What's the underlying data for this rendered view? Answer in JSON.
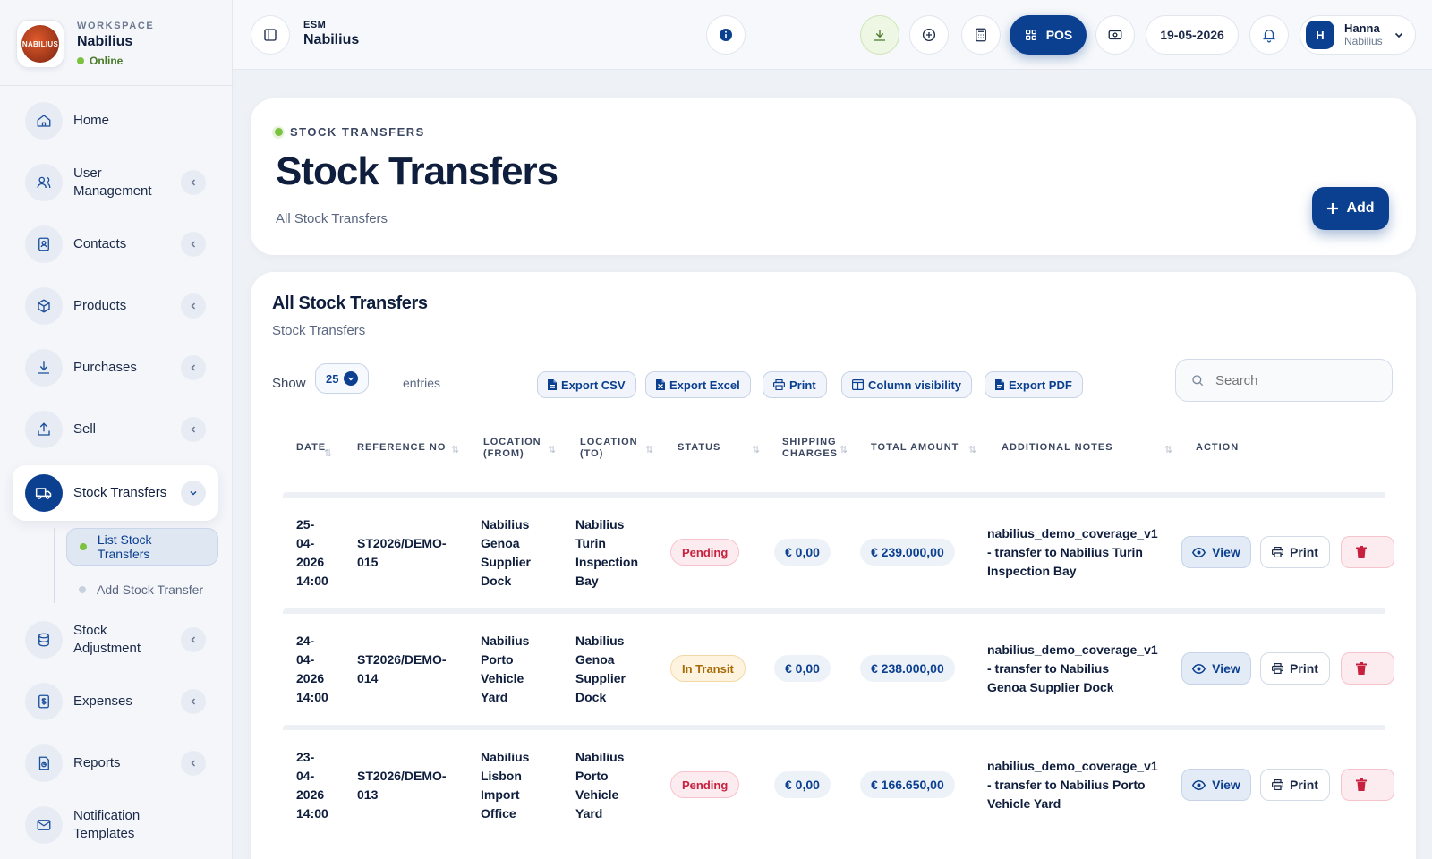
{
  "workspace": {
    "caption": "WORKSPACE",
    "name": "Nabilius",
    "status": "Online",
    "logo_text": "NABILIUS"
  },
  "sidebar": {
    "items": [
      {
        "label": "Home",
        "icon": "home-icon"
      },
      {
        "label": "User Management",
        "icon": "users-icon"
      },
      {
        "label": "Contacts",
        "icon": "contacts-icon"
      },
      {
        "label": "Products",
        "icon": "box-icon"
      },
      {
        "label": "Purchases",
        "icon": "download-icon"
      },
      {
        "label": "Sell",
        "icon": "upload-icon"
      },
      {
        "label": "Stock Transfers",
        "icon": "truck-icon"
      },
      {
        "label": "Stock Adjustment",
        "icon": "database-icon"
      },
      {
        "label": "Expenses",
        "icon": "receipt-icon"
      },
      {
        "label": "Reports",
        "icon": "report-icon"
      },
      {
        "label": "Notification Templates",
        "icon": "mail-icon"
      }
    ],
    "sub_items": [
      "List Stock Transfers",
      "Add Stock Transfer"
    ]
  },
  "topbar": {
    "caption": "ESM",
    "name": "Nabilius",
    "pos_label": "POS",
    "date": "19-05-2026",
    "user_initial": "H",
    "user_name": "Hanna",
    "user_org": "Nabilius"
  },
  "hero": {
    "eyebrow": "STOCK TRANSFERS",
    "title": "Stock Transfers",
    "subtitle": "All Stock Transfers",
    "add_label": "Add"
  },
  "table_card": {
    "title": "All Stock Transfers",
    "subtitle": "Stock Transfers",
    "show_label": "Show",
    "page_size": "25",
    "entries_label": "entries",
    "buttons": [
      "Export CSV",
      "Export Excel",
      "Print",
      "Column visibility",
      "Export PDF"
    ],
    "search_placeholder": "Search",
    "columns": [
      "DATE",
      "REFERENCE NO",
      "LOCATION (FROM)",
      "LOCATION (TO)",
      "STATUS",
      "SHIPPING CHARGES",
      "TOTAL AMOUNT",
      "ADDITIONAL NOTES",
      "ACTION"
    ],
    "rows": [
      {
        "date": "25-\n04-\n2026\n14:00",
        "ref": "ST2026/DEMO-\n015",
        "from": "Nabilius\nGenoa\nSupplier\nDock",
        "to": "Nabilius\nTurin\nInspection\nBay",
        "status": "Pending",
        "shipping": "€ 0,00",
        "total": "€ 239.000,00",
        "notes": "nabilius_demo_coverage_v1\n- transfer to Nabilius Turin\nInspection Bay"
      },
      {
        "date": "24-\n04-\n2026\n14:00",
        "ref": "ST2026/DEMO-\n014",
        "from": "Nabilius\nPorto\nVehicle\nYard",
        "to": "Nabilius\nGenoa\nSupplier\nDock",
        "status": "In Transit",
        "shipping": "€ 0,00",
        "total": "€ 238.000,00",
        "notes": "nabilius_demo_coverage_v1\n- transfer to Nabilius\nGenoa Supplier Dock"
      },
      {
        "date": "23-\n04-\n2026\n14:00",
        "ref": "ST2026/DEMO-\n013",
        "from": "Nabilius\nLisbon\nImport\nOffice",
        "to": "Nabilius\nPorto\nVehicle\nYard",
        "status": "Pending",
        "shipping": "€ 0,00",
        "total": "€ 166.650,00",
        "notes": "nabilius_demo_coverage_v1\n- transfer to Nabilius Porto\nVehicle Yard"
      }
    ],
    "action_labels": {
      "view": "View",
      "print": "Print"
    }
  },
  "colors": {
    "brand": "#0b3f8f",
    "accent_green": "#7cc241",
    "pending": "#c8203f",
    "in_transit": "#a86a06"
  }
}
